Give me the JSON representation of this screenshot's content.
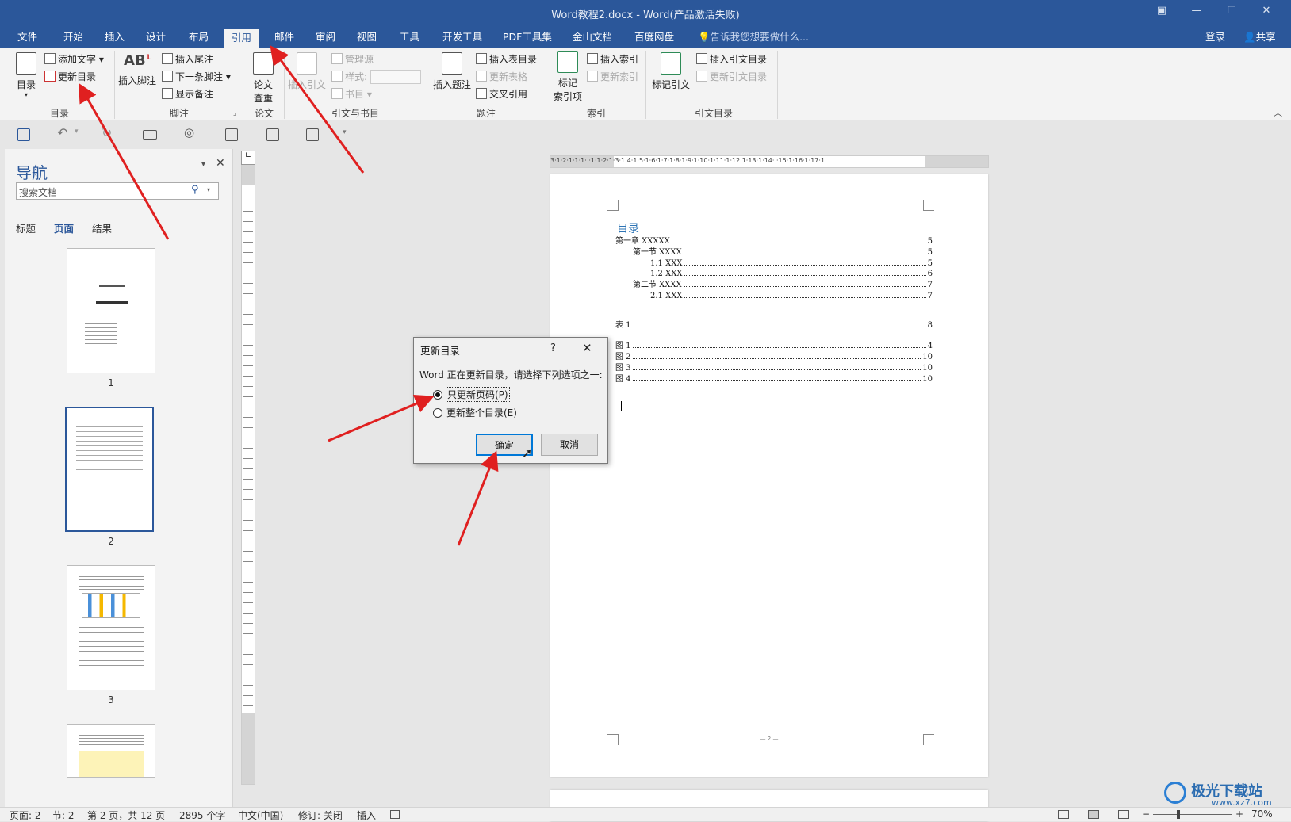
{
  "window": {
    "title": "Word教程2.docx - Word(产品激活失败)"
  },
  "menubar": {
    "tabs": [
      "文件",
      "开始",
      "插入",
      "设计",
      "布局",
      "引用",
      "邮件",
      "审阅",
      "视图",
      "工具",
      "开发工具",
      "PDF工具集",
      "金山文档",
      "百度网盘"
    ],
    "active_tab": "引用",
    "tell_me": "告诉我您想要做什么...",
    "login": "登录",
    "share": "共享"
  },
  "ribbon": {
    "toc": {
      "big_label": "目录",
      "add_text": "添加文字",
      "update_toc": "更新目录",
      "group": "目录"
    },
    "footnotes": {
      "insert_footnote": "插入脚注",
      "insert_endnote": "插入尾注",
      "next_footnote": "下一条脚注",
      "show_notes": "显示备注",
      "group": "脚注"
    },
    "paper": {
      "label1": "论文",
      "label2": "查重",
      "group": "论文"
    },
    "citations": {
      "insert_citation": "插入引文",
      "manage_sources": "管理源",
      "style": "样式:",
      "bibliography": "书目",
      "group": "引文与书目"
    },
    "captions": {
      "insert_caption": "插入题注",
      "insert_table_figures": "插入表目录",
      "update_table": "更新表格",
      "cross_ref": "交叉引用",
      "group": "题注"
    },
    "index": {
      "mark_entry1": "标记",
      "mark_entry2": "索引项",
      "insert_index": "插入索引",
      "update_index": "更新索引",
      "group": "索引"
    },
    "toa": {
      "mark_citation": "标记引文",
      "insert_toa": "插入引文目录",
      "update_toa": "更新引文目录",
      "group": "引文目录"
    }
  },
  "nav": {
    "title": "导航",
    "search_placeholder": "搜索文档",
    "tabs": [
      "标题",
      "页面",
      "结果"
    ],
    "active_tab": "页面",
    "pages": [
      "1",
      "2",
      "3"
    ]
  },
  "ruler": {
    "h_labels": "3·1·2·1·1·1·  ·1·1·2·1·3·1·4·1·5·1·6·1·7·1·8·1·9·1·10·1·11·1·12·1·13·1·14·  ·15·1·16·1·17·1"
  },
  "document": {
    "toc_heading": "目录",
    "entries": [
      {
        "label": "第一章  XXXXX",
        "page": "5"
      },
      {
        "label": "第一节  XXXX",
        "page": "5"
      },
      {
        "label": "1.1 XXX",
        "page": "5"
      },
      {
        "label": "1.2 XXX",
        "page": "6"
      },
      {
        "label": "第二节  XXXX",
        "page": "7"
      },
      {
        "label": "2.1 XXX",
        "page": "7"
      }
    ],
    "tables": [
      {
        "label": "表  1",
        "page": "8"
      }
    ],
    "figures": [
      {
        "label": "图  1",
        "page": "4"
      },
      {
        "label": "图  2",
        "page": "10"
      },
      {
        "label": "图  3",
        "page": "10"
      },
      {
        "label": "图  4",
        "page": "10"
      }
    ],
    "footer": "— 2 —"
  },
  "dialog": {
    "title": "更新目录",
    "help": "?",
    "message": "Word 正在更新目录，请选择下列选项之一:",
    "option1": "只更新页码(P)",
    "option2": "更新整个目录(E)",
    "selected": "只更新页码(P)",
    "ok": "确定",
    "cancel": "取消"
  },
  "status": {
    "page": "页面: 2",
    "section": "节: 2",
    "pages": "第 2 页，共 12 页",
    "words": "2895 个字",
    "lang": "中文(中国)",
    "track": "修订: 关闭",
    "mode": "插入",
    "zoom": "70%"
  },
  "watermark": {
    "text": "极光下载站",
    "url": "www.xz7.com"
  },
  "colors": {
    "accent": "#2b579a",
    "arrow": "#e02020",
    "link": "#2e74b5"
  }
}
